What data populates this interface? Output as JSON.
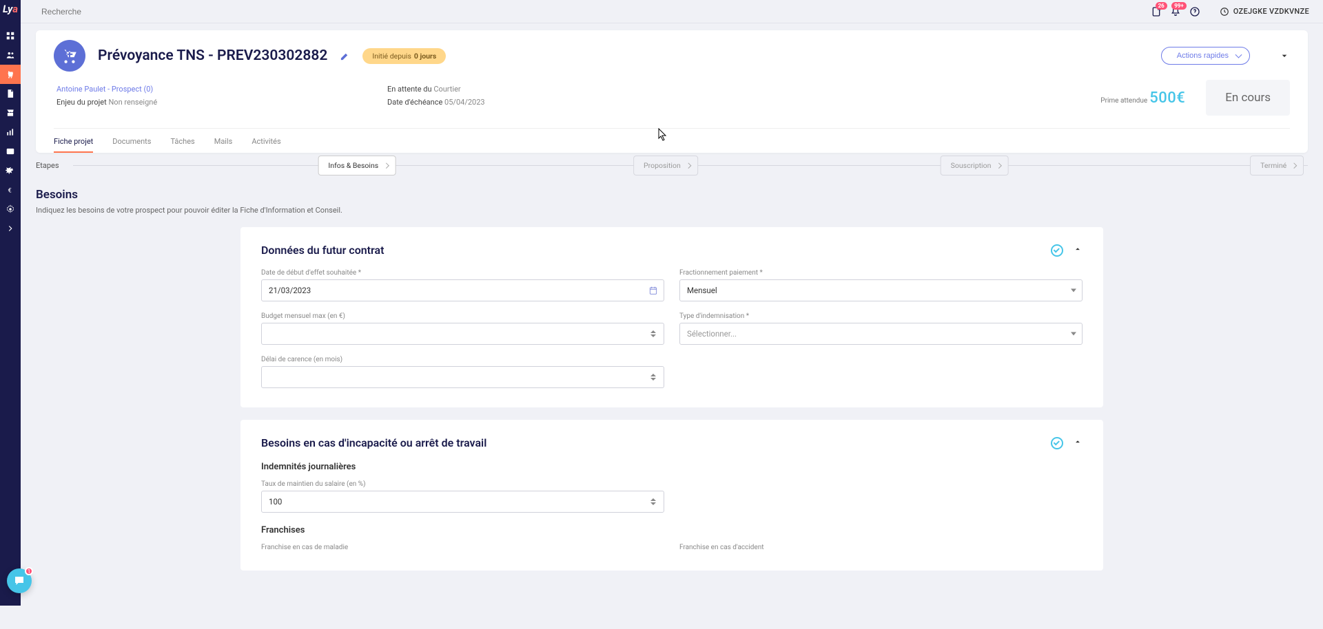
{
  "search_placeholder": "Recherche",
  "topbar": {
    "note_count": "26",
    "bell_count": "99+",
    "user_name": "OZEJGKE VZDKVNZE"
  },
  "project": {
    "title": "Prévoyance TNS - PREV230302882",
    "pill_prefix": "Initié depuis",
    "pill_bold": "0 jours",
    "actions_label": "Actions rapides",
    "client_link": "Antoine Paulet - Prospect (0)",
    "enjeu_label": "Enjeu du projet",
    "enjeu_value": "Non renseigné",
    "attente_label": "En attente du",
    "attente_value": "Courtier",
    "echeance_label": "Date d'échéance",
    "echeance_value": "05/04/2023",
    "prime_label": "Prime attendue",
    "prime_value": "500€",
    "status": "En cours"
  },
  "tabs": {
    "t0": "Fiche projet",
    "t1": "Documents",
    "t2": "Tâches",
    "t3": "Mails",
    "t4": "Activités"
  },
  "stepper": {
    "label": "Etapes",
    "s0": "Infos & Besoins",
    "s1": "Proposition",
    "s2": "Souscription",
    "s3": "Terminé"
  },
  "section": {
    "title": "Besoins",
    "subtitle": "Indiquez les besoins de votre prospect pour pouvoir éditer la Fiche d'Information et Conseil."
  },
  "card1": {
    "title": "Données du futur contrat",
    "date_label": "Date de début d'effet souhaitée *",
    "date_value": "21/03/2023",
    "fraction_label": "Fractionnement paiement *",
    "fraction_value": "Mensuel",
    "budget_label": "Budget mensuel max (en €)",
    "indemn_label": "Type d'indemnisation *",
    "indemn_placeholder": "Sélectionner...",
    "carence_label": "Délai de carence (en mois)"
  },
  "card2": {
    "title": "Besoins en cas d'incapacité ou arrêt de travail",
    "sub1": "Indemnités journalières",
    "taux_label": "Taux de maintien du salaire (en %)",
    "taux_value": "100",
    "sub2": "Franchises",
    "fr_maladie_label": "Franchise en cas de maladie",
    "fr_accident_label": "Franchise en cas d'accident"
  },
  "chat": {
    "badge": "1"
  }
}
